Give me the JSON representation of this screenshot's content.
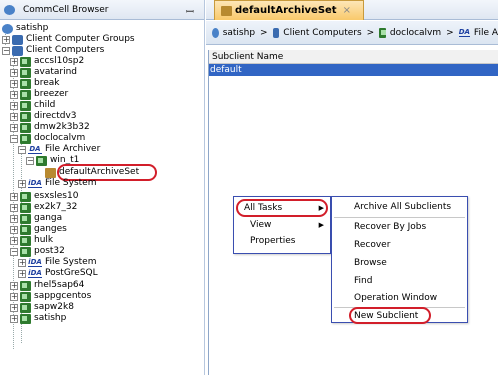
{
  "left_panel": {
    "title": "CommCell Browser",
    "pin_glyph": "ꟷ",
    "tree": [
      {
        "label": "satishp",
        "icon": "commcell-icon",
        "expander": ""
      },
      {
        "label": "Client Computer Groups",
        "icon": "group-icon",
        "expander": "+"
      },
      {
        "label": "Client Computers",
        "icon": "group-icon",
        "expander": "−"
      },
      {
        "label": "accsl10sp2",
        "icon": "server-icon",
        "expander": "+"
      },
      {
        "label": "avatarind",
        "icon": "server-icon",
        "expander": "+"
      },
      {
        "label": "break",
        "icon": "server-icon",
        "expander": "+"
      },
      {
        "label": "breezer",
        "icon": "server-icon",
        "expander": "+"
      },
      {
        "label": "child",
        "icon": "server-icon",
        "expander": "+"
      },
      {
        "label": "directdv3",
        "icon": "server-icon",
        "expander": "+"
      },
      {
        "label": "dmw2k3b32",
        "icon": "server-icon",
        "expander": "+"
      },
      {
        "label": "doclocalvm",
        "icon": "server-icon",
        "expander": "−"
      },
      {
        "label": "File Archiver",
        "icon": "da-icon",
        "expander": "−"
      },
      {
        "label": "win_t1",
        "icon": "instance-icon",
        "expander": "−"
      },
      {
        "label": "defaultArchiveSet",
        "icon": "archiveset-icon",
        "expander": ""
      },
      {
        "label": "File System",
        "icon": "ida-icon",
        "expander": "+"
      },
      {
        "label": "esxsles10",
        "icon": "server-icon",
        "expander": "+"
      },
      {
        "label": "ex2k7_32",
        "icon": "server-icon",
        "expander": "+"
      },
      {
        "label": "ganga",
        "icon": "server-icon",
        "expander": "+"
      },
      {
        "label": "ganges",
        "icon": "server-icon",
        "expander": "+"
      },
      {
        "label": "hulk",
        "icon": "server-icon",
        "expander": "+"
      },
      {
        "label": "post32",
        "icon": "server-icon",
        "expander": "−"
      },
      {
        "label": "File System",
        "icon": "ida-icon",
        "expander": "+"
      },
      {
        "label": "PostGreSQL",
        "icon": "ida-icon",
        "expander": "+"
      },
      {
        "label": "rhel5sap64",
        "icon": "server-icon",
        "expander": "+"
      },
      {
        "label": "sappgcentos",
        "icon": "server-icon",
        "expander": "+"
      },
      {
        "label": "sapw2k8",
        "icon": "server-icon",
        "expander": "+"
      },
      {
        "label": "satishp",
        "icon": "server-icon",
        "expander": "+"
      }
    ],
    "da_badge": "DA",
    "ida_badge": "iDA"
  },
  "right_panel": {
    "tab_label": "defaultArchiveSet",
    "tab_close": "×",
    "breadcrumb": [
      "satishp",
      "Client Computers",
      "doclocalvm",
      "File A"
    ],
    "breadcrumb_sep": ">",
    "column_header": "Subclient Name",
    "rows": [
      "default"
    ]
  },
  "context_menu": {
    "items": [
      "All Tasks",
      "View",
      "Properties"
    ],
    "arrow_glyph": "▶"
  },
  "submenu": {
    "items": [
      "Archive All Subclients",
      "Recover By Jobs",
      "Recover",
      "Browse",
      "Find",
      "Operation Window",
      "New Subclient"
    ]
  },
  "colors": {
    "selection": "#3165c4",
    "highlight_oval": "#d21e2a",
    "menu_border": "#3a4eb0",
    "tab_fill": "#f9c96b"
  }
}
